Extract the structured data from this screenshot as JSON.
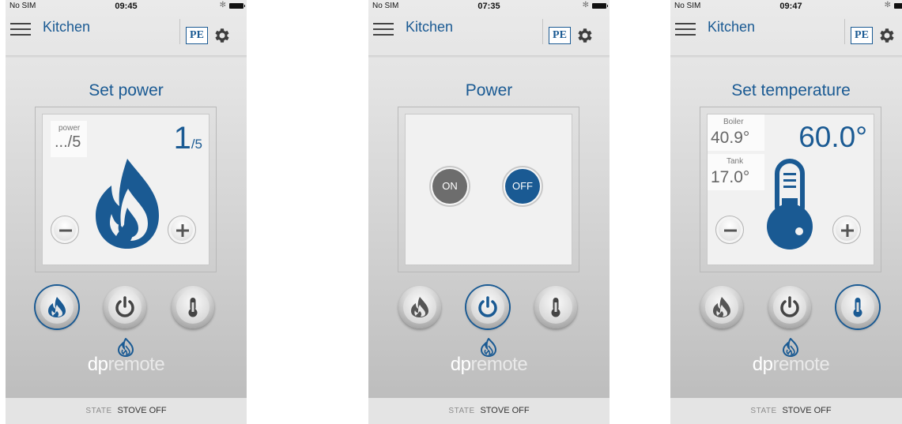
{
  "status": {
    "carrier": "No SIM",
    "bluetooth": "✻"
  },
  "screens": [
    {
      "time": "09:45",
      "nav": {
        "title": "Kitchen",
        "pe_label": "PE"
      },
      "panel_title": "Set power",
      "power_label": "power",
      "power_current": ".../5",
      "power_set": "1",
      "power_max": "/5",
      "state": {
        "label": "STATE",
        "value": "STOVE OFF"
      },
      "brand": {
        "part1": "dp",
        "part2": "remote"
      },
      "active_mode": "flame"
    },
    {
      "time": "07:35",
      "nav": {
        "title": "Kitchen",
        "pe_label": "PE"
      },
      "panel_title": "Power",
      "on_label": "ON",
      "off_label": "OFF",
      "state": {
        "label": "STATE",
        "value": "STOVE OFF"
      },
      "brand": {
        "part1": "dp",
        "part2": "remote"
      },
      "active_mode": "power"
    },
    {
      "time": "09:47",
      "nav": {
        "title": "Kitchen",
        "pe_label": "PE"
      },
      "panel_title": "Set temperature",
      "boiler_label": "Boiler",
      "boiler_value": "40.9°",
      "tank_label": "Tank",
      "tank_value": "17.0°",
      "temp_set": "60.0°",
      "state": {
        "label": "STATE",
        "value": "STOVE OFF"
      },
      "brand": {
        "part1": "dp",
        "part2": "remote"
      },
      "active_mode": "temperature"
    }
  ],
  "colors": {
    "accent": "#1a5a93",
    "off_button": "#1a5a93",
    "on_button": "#6d6d6d"
  }
}
